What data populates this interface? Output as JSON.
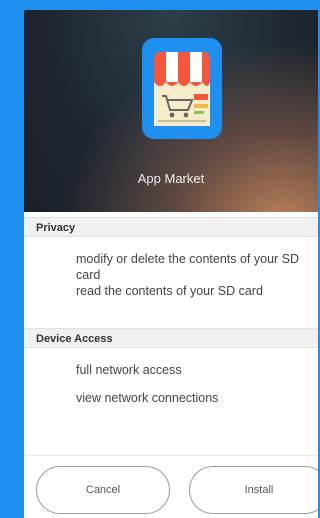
{
  "app": {
    "name": "App Market"
  },
  "sections": {
    "privacy": {
      "title": "Privacy",
      "items": [
        "modify or delete the contents of your SD",
        "card",
        "read the contents of your SD card"
      ]
    },
    "device_access": {
      "title": "Device Access",
      "items": [
        "full network access",
        "view network connections"
      ]
    }
  },
  "buttons": {
    "cancel": "Cancel",
    "install": "Install"
  },
  "colors": {
    "frame_blue": "#1f8ff0",
    "icon_blue": "#1f8ff0",
    "awning_orange": "#f5553c",
    "awning_white": "#ffffff"
  }
}
